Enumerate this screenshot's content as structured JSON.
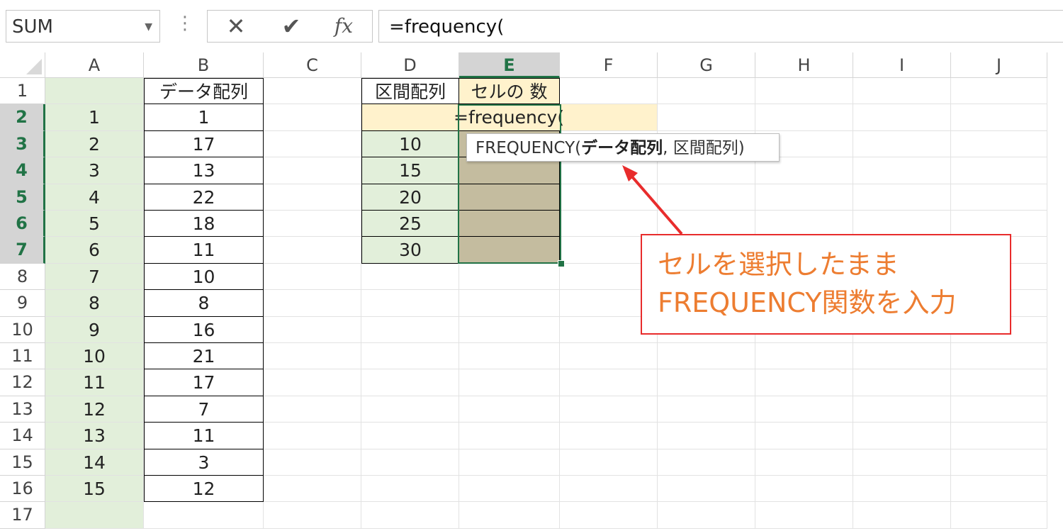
{
  "formula_bar": {
    "name_box": "SUM",
    "cancel_icon": "✕",
    "enter_icon": "✔",
    "fx_label": "fx",
    "formula": "=frequency("
  },
  "columns": [
    "A",
    "B",
    "C",
    "D",
    "E",
    "F",
    "G",
    "H",
    "I",
    "J"
  ],
  "rows": [
    "1",
    "2",
    "3",
    "4",
    "5",
    "6",
    "7",
    "8",
    "9",
    "10",
    "11",
    "12",
    "13",
    "14",
    "15",
    "16",
    "17"
  ],
  "selected_column": "E",
  "selected_rows": [
    "2",
    "3",
    "4",
    "5",
    "6",
    "7"
  ],
  "cells": {
    "B1": "データ配列",
    "D1": "区間配列",
    "E1": "セルの 数",
    "A": [
      "1",
      "2",
      "3",
      "4",
      "5",
      "6",
      "7",
      "8",
      "9",
      "10",
      "11",
      "12",
      "13",
      "14",
      "15"
    ],
    "B": [
      "1",
      "17",
      "13",
      "22",
      "18",
      "11",
      "10",
      "8",
      "16",
      "21",
      "17",
      "7",
      "11",
      "3",
      "12"
    ],
    "D": [
      "10",
      "15",
      "20",
      "25",
      "30"
    ],
    "editing_cell": "=frequency("
  },
  "tooltip": {
    "prefix": "FREQUENCY(",
    "arg_bold": "データ配列",
    "suffix": ", 区間配列)"
  },
  "annotation": {
    "line1": "セルを選択したまま",
    "line2": "FREQUENCY関数を入力"
  },
  "colors": {
    "green_fill": "#e2efda",
    "tan_fill": "#c4bc9f",
    "edit_fill": "#fff2cc",
    "accent": "#217346",
    "callout_border": "#e82c2c",
    "callout_text": "#ed7d31"
  }
}
